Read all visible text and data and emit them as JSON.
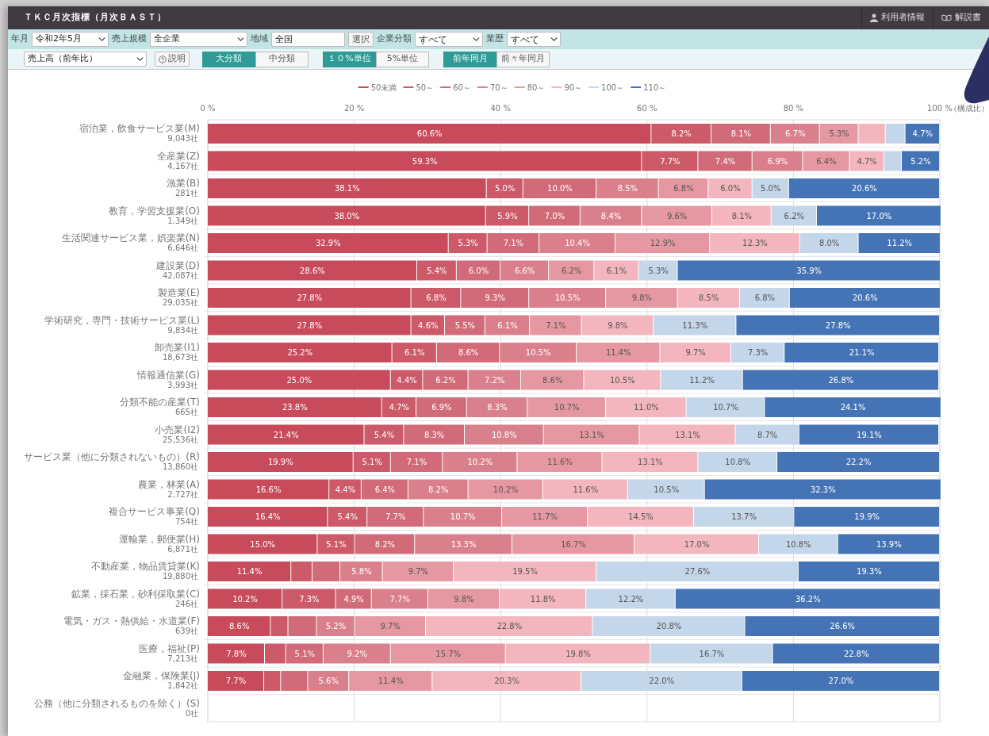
{
  "header": {
    "title": "ＴＫＣ月次指標（月次ＢＡＳＴ）",
    "links": [
      {
        "label": "利用者情報"
      },
      {
        "label": "解説書"
      }
    ]
  },
  "filters": [
    {
      "kind": "select",
      "label": "年月",
      "value": "令和2年5月"
    },
    {
      "kind": "select",
      "label": "売上規模",
      "value": "全企業"
    },
    {
      "kind": "text",
      "label": "地域",
      "value": "全国",
      "button": "選択"
    },
    {
      "kind": "select",
      "label": "企業分類",
      "value": "すべて"
    },
    {
      "kind": "select",
      "label": "業歴",
      "value": "すべて"
    }
  ],
  "options": {
    "indicator": "売上高（前年比）",
    "help_button": "説明",
    "toggle_groups": [
      [
        {
          "label": "大分類",
          "selected": true
        },
        {
          "label": "中分類",
          "selected": false
        }
      ],
      [
        {
          "label": "１０%単位",
          "selected": true
        },
        {
          "label": "5%単位",
          "selected": false
        }
      ],
      [
        {
          "label": "前年同月",
          "selected": true
        },
        {
          "label": "前々年同月",
          "selected": false
        }
      ]
    ]
  },
  "chart": {
    "company_counts": [
      "9,043社",
      "4,167社",
      "281社",
      "1,349社",
      "6,646社",
      "42,087社",
      "29,035社",
      "9,834社",
      "18,673社",
      "3,993社",
      "665社",
      "25,536社",
      "13,860社",
      "2,727社",
      "754社",
      "6,871社",
      "19,880社",
      "246社",
      "639社",
      "7,213社",
      "1,842社",
      "0社"
    ],
    "chart_data": {
      "type": "bar",
      "orientation": "horizontal",
      "stacked": true,
      "grid": true,
      "legend": true,
      "xlabel": "（構成比）",
      "xlim": [
        0,
        100
      ],
      "value_labels": [
        [
          "60.6%",
          "59.3%",
          "38.1%",
          "38.0%",
          "32.9%",
          "28.6%",
          "27.8%",
          "27.8%",
          "25.2%",
          "25.0%",
          "23.8%",
          "21.4%",
          "19.9%",
          "16.6%",
          "16.4%",
          "15.0%",
          "11.4%",
          "10.2%",
          "8.6%",
          "7.8%",
          "7.7%",
          null
        ],
        [
          "8.2%",
          "7.7%",
          "5.0%",
          "5.9%",
          "5.3%",
          "5.4%",
          "6.8%",
          "4.6%",
          "6.1%",
          "4.4%",
          "4.7%",
          "5.4%",
          "5.1%",
          "4.4%",
          "5.4%",
          "5.1%",
          null,
          "7.3%",
          null,
          null,
          null,
          null
        ],
        [
          "8.1%",
          "7.4%",
          "10.0%",
          "7.0%",
          "7.1%",
          "6.0%",
          "9.3%",
          "5.5%",
          "8.6%",
          "6.2%",
          "6.9%",
          "8.3%",
          "7.1%",
          "6.4%",
          "7.7%",
          "8.2%",
          null,
          "4.9%",
          null,
          "5.1%",
          null,
          null
        ],
        [
          "6.7%",
          "6.9%",
          "8.5%",
          "8.4%",
          "10.4%",
          "6.6%",
          "10.5%",
          "6.1%",
          "10.5%",
          "7.2%",
          "8.3%",
          "10.8%",
          "10.2%",
          "8.2%",
          "10.7%",
          "13.3%",
          "5.8%",
          "7.7%",
          "5.2%",
          "9.2%",
          "5.6%",
          null
        ],
        [
          "5.3%",
          "6.4%",
          "6.8%",
          "9.6%",
          "12.9%",
          "6.2%",
          "9.8%",
          "7.1%",
          "11.4%",
          "8.6%",
          "10.7%",
          "13.1%",
          "11.6%",
          "10.2%",
          "11.7%",
          "16.7%",
          "9.7%",
          "9.8%",
          "9.7%",
          "15.7%",
          "11.4%",
          null
        ],
        [
          null,
          "4.7%",
          "6.0%",
          "8.1%",
          "12.3%",
          "6.1%",
          "8.5%",
          "9.8%",
          "9.7%",
          "10.5%",
          "11.0%",
          "13.1%",
          "13.1%",
          "11.6%",
          "14.5%",
          "17.0%",
          "19.5%",
          "11.8%",
          "22.8%",
          "19.8%",
          "20.3%",
          null
        ],
        [
          null,
          null,
          "5.0%",
          "6.2%",
          "8.0%",
          "5.3%",
          "6.8%",
          "11.3%",
          "7.3%",
          "11.2%",
          "10.7%",
          "8.7%",
          "10.8%",
          "10.5%",
          "13.7%",
          "10.8%",
          "27.6%",
          "12.2%",
          "20.8%",
          "16.7%",
          "22.0%",
          null
        ],
        [
          "4.7%",
          "5.2%",
          "20.6%",
          "17.0%",
          "11.2%",
          "35.9%",
          "20.6%",
          "27.8%",
          "21.1%",
          "26.8%",
          "24.1%",
          "19.1%",
          "22.2%",
          "32.3%",
          "19.9%",
          "13.9%",
          "19.3%",
          "36.2%",
          "26.6%",
          "22.8%",
          "27.0%",
          null
        ]
      ],
      "xticks": [
        {
          "value": 0,
          "label": "0 %"
        },
        {
          "value": 20,
          "label": "20 %"
        },
        {
          "value": 40,
          "label": "40 %"
        },
        {
          "value": 60,
          "label": "60 %"
        },
        {
          "value": 80,
          "label": "80 %"
        },
        {
          "value": 100,
          "label": "100 %"
        }
      ],
      "categories": [
        "宿泊業，飲食サービス業(M)",
        "全産業(Z)",
        "漁業(B)",
        "教育，学習支援業(O)",
        "生活関連サービス業，娯楽業(N)",
        "建設業(D)",
        "製造業(E)",
        "学術研究，専門・技術サービス業(L)",
        "卸売業(I1)",
        "情報通信業(G)",
        "分類不能の産業(T)",
        "小売業(I2)",
        "サービス業（他に分類されないもの）(R)",
        "農業，林業(A)",
        "複合サービス事業(Q)",
        "運輸業，郵便業(H)",
        "不動産業，物品賃貸業(K)",
        "鉱業，採石業，砂利採取業(C)",
        "電気・ガス・熱供給・水道業(F)",
        "医療，福祉(P)",
        "金融業，保険業(J)",
        "公務（他に分類されるものを除く）(S)"
      ],
      "series": [
        {
          "name": "50未満",
          "color": "#c84b5b",
          "values": [
            60.6,
            59.3,
            38.1,
            38.0,
            32.9,
            28.6,
            27.8,
            27.8,
            25.2,
            25.0,
            23.8,
            21.4,
            19.9,
            16.6,
            16.4,
            15.0,
            11.4,
            10.2,
            8.6,
            7.8,
            7.7,
            null
          ]
        },
        {
          "name": "50～",
          "color": "#cc5a69",
          "values": [
            8.2,
            7.7,
            5.0,
            5.9,
            5.3,
            5.4,
            6.8,
            4.6,
            6.1,
            4.4,
            4.7,
            5.4,
            5.1,
            4.4,
            5.4,
            5.1,
            2.9,
            7.3,
            2.4,
            2.9,
            2.3,
            null
          ]
        },
        {
          "name": "60～",
          "color": "#d26b79",
          "values": [
            8.1,
            7.4,
            10.0,
            7.0,
            7.1,
            6.0,
            9.3,
            5.5,
            8.6,
            6.2,
            6.9,
            8.3,
            7.1,
            6.4,
            7.7,
            8.2,
            3.8,
            4.9,
            3.9,
            5.1,
            3.7,
            null
          ]
        },
        {
          "name": "70～",
          "color": "#da808c",
          "values": [
            6.7,
            6.9,
            8.5,
            8.4,
            10.4,
            6.6,
            10.5,
            6.1,
            10.5,
            7.2,
            8.3,
            10.8,
            10.2,
            8.2,
            10.7,
            13.3,
            5.8,
            7.7,
            5.2,
            9.2,
            5.6,
            null
          ]
        },
        {
          "name": "80～",
          "color": "#e698a2",
          "values": [
            5.3,
            6.4,
            6.8,
            9.6,
            12.9,
            6.2,
            9.8,
            7.1,
            11.4,
            8.6,
            10.7,
            13.1,
            11.6,
            10.2,
            11.7,
            16.7,
            9.7,
            9.8,
            9.7,
            15.7,
            11.4,
            null
          ]
        },
        {
          "name": "90～",
          "color": "#f4b6be",
          "values": [
            3.7,
            4.7,
            6.0,
            8.1,
            12.3,
            6.1,
            8.5,
            9.8,
            9.7,
            10.5,
            11.0,
            13.1,
            13.1,
            11.6,
            14.5,
            17.0,
            19.5,
            11.8,
            22.8,
            19.8,
            20.3,
            null
          ]
        },
        {
          "name": "100～",
          "color": "#c4d6ea",
          "values": [
            2.7,
            2.4,
            5.0,
            6.2,
            8.0,
            5.3,
            6.8,
            11.3,
            7.3,
            11.2,
            10.7,
            8.7,
            10.8,
            10.5,
            13.7,
            10.8,
            27.6,
            12.2,
            20.8,
            16.7,
            22.0,
            null
          ]
        },
        {
          "name": "110～",
          "color": "#4574b6",
          "values": [
            4.7,
            5.2,
            20.6,
            17.0,
            11.2,
            35.9,
            20.6,
            27.8,
            21.1,
            26.8,
            24.1,
            19.1,
            22.2,
            32.3,
            19.9,
            13.9,
            19.3,
            36.2,
            26.6,
            22.8,
            27.0,
            null
          ]
        }
      ]
    }
  }
}
